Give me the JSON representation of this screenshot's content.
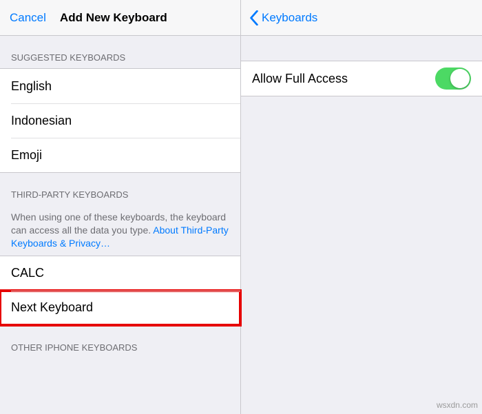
{
  "left": {
    "nav": {
      "cancel": "Cancel",
      "title": "Add New Keyboard"
    },
    "suggested": {
      "header": "Suggested Keyboards",
      "items": [
        "English",
        "Indonesian",
        "Emoji"
      ]
    },
    "thirdparty": {
      "header": "Third-Party Keyboards",
      "footer_prefix": "When using one of these keyboards, the keyboard can access all the data you type. ",
      "footer_link": "About Third-Party Keyboards & Privacy…",
      "items": [
        "CALC",
        "Next Keyboard"
      ]
    },
    "other": {
      "header": "Other iPhone Keyboards"
    }
  },
  "right": {
    "nav": {
      "back": "Keyboards"
    },
    "allow": {
      "label": "Allow Full Access",
      "on": true
    }
  },
  "watermark": "wsxdn.com"
}
